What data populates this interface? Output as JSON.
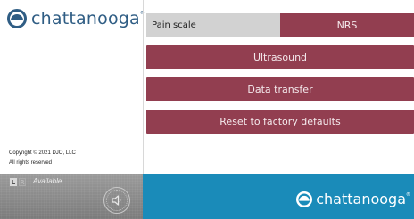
{
  "brand": {
    "name": "chattanooga",
    "tm": "®"
  },
  "footer_left": {
    "copyright": "Copyright © 2021 DJO, LLC",
    "rights": "All rights reserved",
    "channel_l": "L",
    "channel_r": "R",
    "status": "Available"
  },
  "settings": {
    "pain_scale_label": "Pain scale",
    "pain_scale_value": "NRS",
    "buttons": [
      "Ultrasound",
      "Data transfer",
      "Reset to factory defaults"
    ]
  },
  "colors": {
    "button": "#923e50",
    "label_bg": "#d2d2d2",
    "brand_blue": "#1a8bb9",
    "logo_blue": "#2f5d84"
  }
}
